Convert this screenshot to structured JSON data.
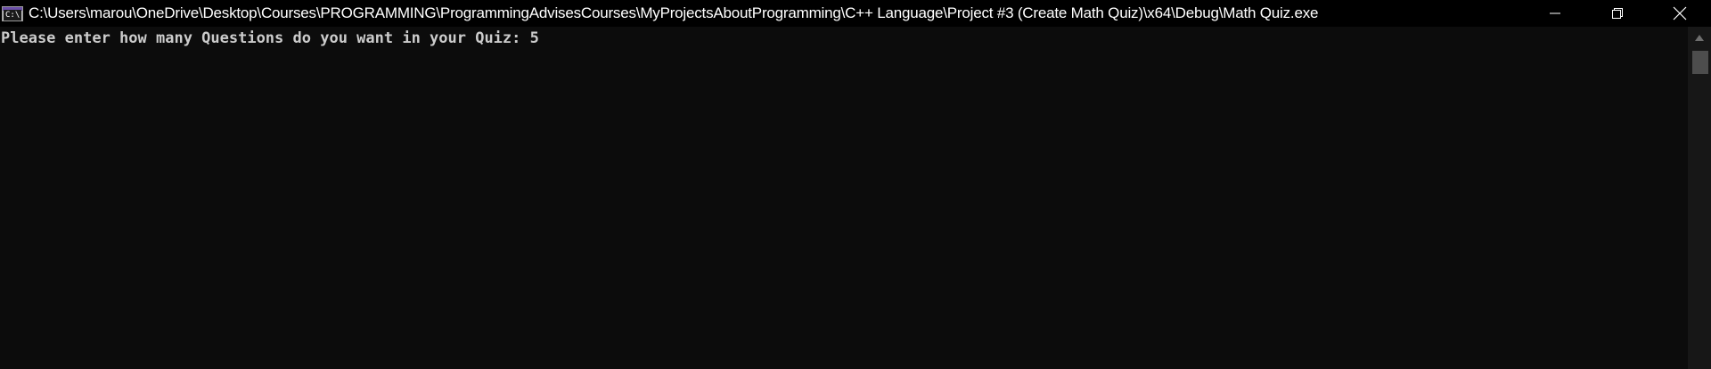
{
  "window": {
    "title": "C:\\Users\\marou\\OneDrive\\Desktop\\Courses\\PROGRAMMING\\ProgrammingAdvisesCourses\\MyProjectsAboutProgramming\\C++ Language\\Project #3 (Create Math Quiz)\\x64\\Debug\\Math Quiz.exe",
    "icon_label": "C:\\",
    "icon": "console-app-icon",
    "controls": [
      "minimize-icon",
      "restore-icon",
      "close-icon"
    ]
  },
  "console": {
    "prompt": "Please enter how many Questions do you want in your Quiz: ",
    "input": "5",
    "text_color": "#cccccc",
    "background": "#0c0c0c"
  },
  "scrollbar": {
    "up_icon": "scroll-up-arrow-icon"
  }
}
